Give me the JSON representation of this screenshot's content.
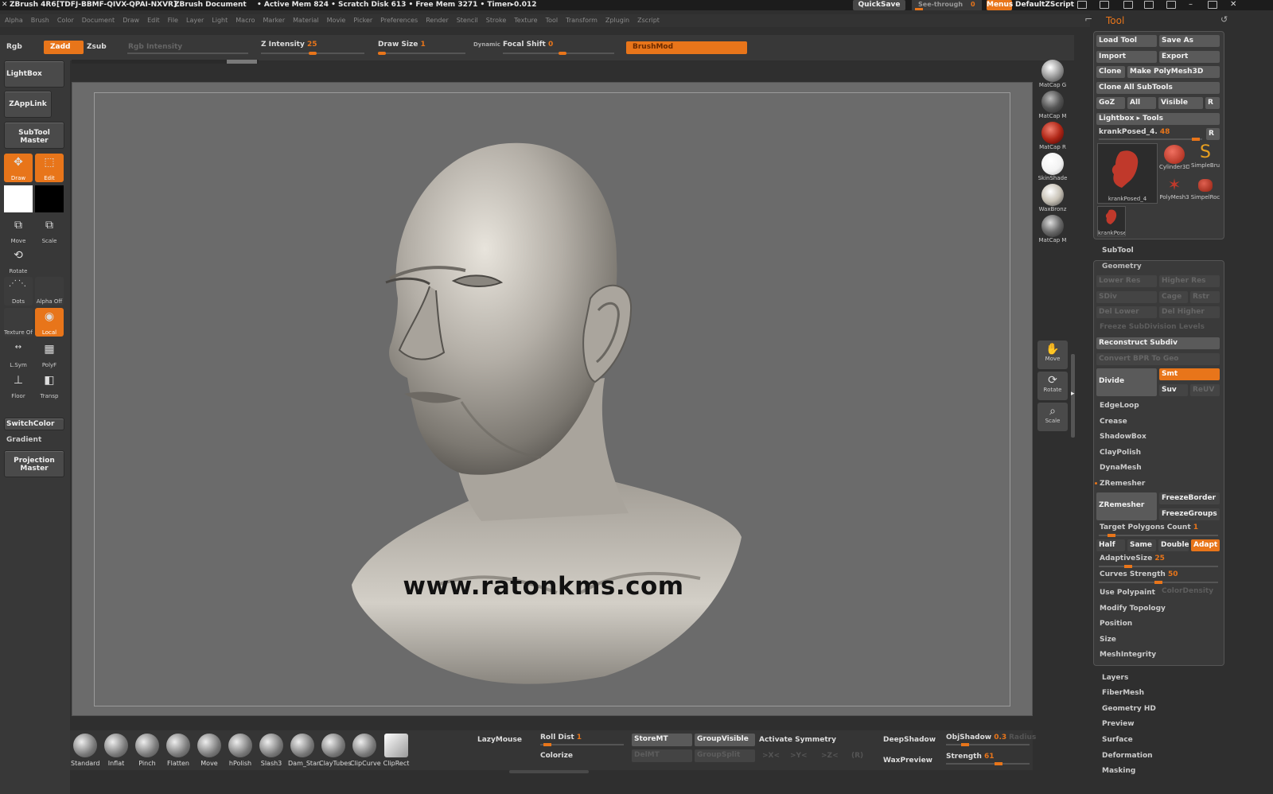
{
  "titlebar": {
    "app": "ZBrush 4R6",
    "code": "[TDFJ-BBMF-QIVX-QPAI-NXVR]",
    "document": "ZBrush Document",
    "stats": "• Active Mem 824 • Scratch Disk 613 • Free Mem 3271 • Timer▸0.012",
    "quicksave": "QuickSave",
    "seethrough": "See-through",
    "seethrough_value": "0",
    "menus": "Menus",
    "script": "DefaultZScript"
  },
  "menubar": [
    "Alpha",
    "Brush",
    "Color",
    "Document",
    "Draw",
    "Edit",
    "File",
    "Layer",
    "Light",
    "Macro",
    "Marker",
    "Material",
    "Movie",
    "Picker",
    "Preferences",
    "Render",
    "Stencil",
    "Stroke",
    "Texture",
    "Tool",
    "Transform",
    "Zplugin",
    "Zscript"
  ],
  "topbar": {
    "rgb": "Rgb",
    "zadd": "Zadd",
    "zsub": "Zsub",
    "rgb_intensity": "Rgb Intensity",
    "z_intensity_label": "Z Intensity",
    "z_intensity_value": "25",
    "draw_size_label": "Draw Size",
    "draw_size_value": "1",
    "dynamic": "Dynamic",
    "focal_shift_label": "Focal Shift",
    "focal_shift_value": "0",
    "brushmod": "BrushMod"
  },
  "left": {
    "lightbox": "LightBox",
    "zapplink": "ZAppLink",
    "subtool_master_1": "SubTool",
    "subtool_master_2": "Master",
    "draw": "Draw",
    "edit": "Edit",
    "move": "Move",
    "scale": "Scale",
    "rotate": "Rotate",
    "dots": "Dots",
    "alpha": "Alpha  Off",
    "texture": "Texture  Off",
    "local": "Local",
    "lsym": "L.Sym",
    "polyf": "PolyF",
    "floor": "Floor",
    "transp": "Transp",
    "switchcolor": "SwitchColor",
    "gradient": "Gradient",
    "projection_1": "Projection",
    "projection_2": "Master"
  },
  "materials": [
    {
      "label": "MatCap  G",
      "color": "#9a9a9a"
    },
    {
      "label": "MatCap  M",
      "color": "#555555"
    },
    {
      "label": "MatCap  R",
      "color": "#b02818"
    },
    {
      "label": "SkinShade",
      "color": "#f2f2f2"
    },
    {
      "label": "WaxBronz",
      "color": "#c8c2b6"
    },
    {
      "label": "MatCap  M",
      "color": "#6a6a6a"
    }
  ],
  "nav": {
    "move": "Move",
    "rotate": "Rotate",
    "scale": "Scale"
  },
  "watermark": "www.ratonkms.com",
  "tool": {
    "title": "Tool",
    "load": "Load Tool",
    "saveas": "Save As",
    "import": "Import",
    "export": "Export",
    "clone": "Clone",
    "make_polymesh": "Make PolyMesh3D",
    "clone_all": "Clone All SubTools",
    "goz": "GoZ",
    "all": "All",
    "visible": "Visible",
    "r": "R",
    "lightbox_tools": "Lightbox ▸ Tools",
    "current_label": "krankPosed_4.",
    "current_value": "48",
    "thumb_main": "krankPosed_4",
    "thumb_cyl": "Cylinder3D",
    "thumb_simple": "SimpleBru",
    "thumb_poly": "PolyMesh3",
    "thumb_rock": "SimpelRoc",
    "thumb_small": "krankPose"
  },
  "geometry": {
    "subtool": "SubTool",
    "geometry": "Geometry",
    "lower_res": "Lower Res",
    "higher_res": "Higher Res",
    "sdiv": "SDiv",
    "cage": "Cage",
    "rstr": "Rstr",
    "del_lower": "Del Lower",
    "del_higher": "Del Higher",
    "freeze": "Freeze SubDivision Levels",
    "reconstruct": "Reconstruct Subdiv",
    "convert": "Convert BPR To Geo",
    "divide": "Divide",
    "smt": "Smt",
    "suv": "Suv",
    "reuv": "ReUV",
    "edgeloop": "EdgeLoop",
    "crease": "Crease",
    "shadowbox": "ShadowBox",
    "claypolish": "ClayPolish",
    "dynamesh": "DynaMesh",
    "zremesher_title": "ZRemesher",
    "zremesher_btn": "ZRemesher",
    "freezeborder": "FreezeBorder",
    "freezegroups": "FreezeGroups",
    "target_label": "Target Polygons Count",
    "target_value": "1",
    "half": "Half",
    "same": "Same",
    "double": "Double",
    "adapt": "Adapt",
    "adaptive_label": "AdaptiveSize",
    "adaptive_value": "25",
    "curves_label": "Curves Strength",
    "curves_value": "50",
    "use_polypaint": "Use Polypaint",
    "color_density": "ColorDensity",
    "modify_topology": "Modify Topology",
    "position": "Position",
    "size": "Size",
    "meshintegrity": "MeshIntegrity"
  },
  "lower_sections": [
    "Layers",
    "FiberMesh",
    "Geometry HD",
    "Preview",
    "Surface",
    "Deformation",
    "Masking"
  ],
  "brushes": [
    "Standard",
    "Inflat",
    "Pinch",
    "Flatten",
    "Move",
    "hPolish",
    "Slash3",
    "Dam_Stan",
    "ClayTubes",
    "ClipCurve",
    "ClipRect"
  ],
  "bottom": {
    "lazymouse": "LazyMouse",
    "roll_dist_label": "Roll Dist",
    "roll_dist_value": "1",
    "colorize": "Colorize",
    "storemt": "StoreMT",
    "delmt": "DelMT",
    "groupvisible": "GroupVisible",
    "groupsplit": "GroupSplit",
    "activate_symmetry": "Activate Symmetry",
    "sym_x": ">X<",
    "sym_y": ">Y<",
    "sym_z": ">Z<",
    "sym_r": "(R)",
    "deepshadow": "DeepShadow",
    "waxpreview": "WaxPreview",
    "objshadow_label": "ObjShadow",
    "objshadow_value": "0.3",
    "radius": "Radius",
    "strength_label": "Strength",
    "strength_value": "61"
  }
}
